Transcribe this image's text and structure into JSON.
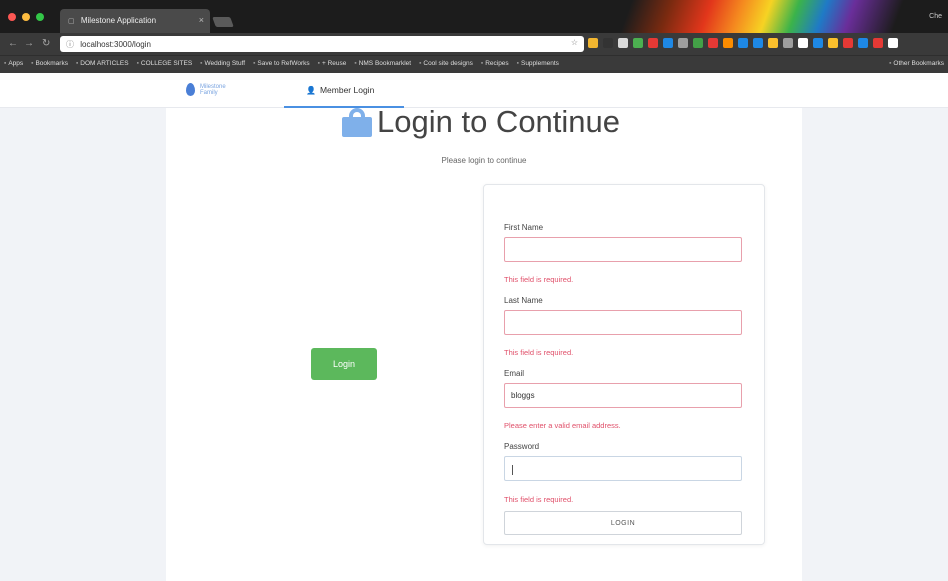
{
  "browser": {
    "tab_title": "Milestone Application",
    "tab_close": "×",
    "profile": "Che",
    "url": "localhost:3000/login",
    "omnibox_right": "☆",
    "bookmarks": [
      "Apps",
      "Bookmarks",
      "DOM ARTICLES",
      "COLLEGE SITES",
      "Wedding Stuff",
      "Save to RefWorks",
      "+ Reuse",
      "NMS Bookmarklet",
      "Cool site designs",
      "Recipes",
      "Supplements"
    ],
    "other_bookmarks": "Other Bookmarks",
    "extension_colors": [
      "#f2b630",
      "#333333",
      "#d9d9d9",
      "#4caf50",
      "#e53935",
      "#1e88e5",
      "#9e9e9e",
      "#43a047",
      "#e53935",
      "#fb8c00",
      "#1e88e5",
      "#1e88e5",
      "#fbc02d",
      "#9e9e9e",
      "#ffffff",
      "#1e88e5",
      "#fbc02d",
      "#e53935",
      "#1e88e5",
      "#e53935",
      "#ffffff"
    ]
  },
  "header": {
    "logo_line1": "Milestone",
    "logo_line2": "Family",
    "nav_item": "Member Login",
    "accent": "#4a90e2"
  },
  "main": {
    "title": "Login to Continue",
    "subtitle": "Please login to continue",
    "login_button": "Login",
    "login_button_color": "#5cb85c"
  },
  "form": {
    "fields": [
      {
        "label": "First Name",
        "value": "",
        "error": "This field is required."
      },
      {
        "label": "Last Name",
        "value": "",
        "error": "This field is required."
      },
      {
        "label": "Email",
        "value": "bloggs",
        "error": "Please enter a valid email address."
      },
      {
        "label": "Password",
        "value": "",
        "error": "This field is required."
      }
    ],
    "submit": "LOGIN",
    "error_color": "#e0506a"
  }
}
